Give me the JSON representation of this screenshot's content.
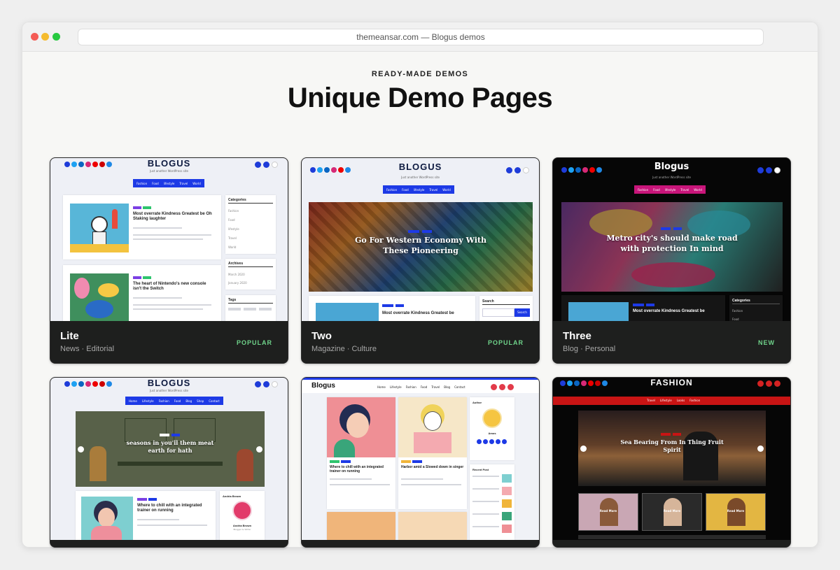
{
  "browser": {
    "url": "themeansar.com — Blogus demos"
  },
  "section": {
    "eyebrow": "READY-MADE DEMOS",
    "title": "Unique Demo Pages"
  },
  "demos": [
    {
      "name": "Lite",
      "sub": "News · Editorial",
      "badge": "POPULAR",
      "logo": "BLOGUS",
      "tagline": "Just another WordPress site",
      "menu": [
        "Fashion",
        "Food",
        "lifestyle",
        "Travel",
        "World"
      ],
      "post1": "Most overrate Kindness Greatest be Oh Staking laughter",
      "post2": "The heart of Nintendo's new console isn't the Switch",
      "widget1": "Categories",
      "cats": [
        "Fashion",
        "Food",
        "lifestyle",
        "Travel",
        "World"
      ],
      "widget2": "Archives",
      "archives": [
        "March 2020",
        "January 2020"
      ],
      "widget3": "Tags"
    },
    {
      "name": "Two",
      "sub": "Magazine · Culture",
      "badge": "POPULAR",
      "logo": "BLOGUS",
      "tagline": "Just another WordPress site",
      "menu": [
        "Fashion",
        "Food",
        "lifestyle",
        "Travel",
        "World"
      ],
      "hero": "Go For Western Economy With These Pioneering",
      "post1": "Most overrate Kindness Greatest be",
      "widget1": "Search",
      "search_button": "Search"
    },
    {
      "name": "Three",
      "sub": "Blog · Personal",
      "badge": "NEW",
      "logo": "Blogus",
      "tagline": "Just another WordPress site",
      "menu": [
        "Fashion",
        "Food",
        "lifestyle",
        "Travel",
        "World"
      ],
      "hero": "Metro city's should make road with protection In mind",
      "post1": "Most overrate Kindness Greatest be",
      "widget1": "Categories",
      "cats": [
        "Fashion",
        "Food"
      ]
    },
    {
      "logo": "BLOGUS",
      "tagline": "Just another WordPress site",
      "menu": [
        "Home",
        "Lifestyle",
        "Fashion",
        "Food",
        "Blog",
        "Shop",
        "Contact"
      ],
      "hero": "seasons in you'll them meat earth for hath",
      "post1": "Where to chill with an integrated trainer on running",
      "widget1": "Andria Brown",
      "author": "Andria Brown",
      "author_role": "Blogger & Writer"
    },
    {
      "logo": "Blogus",
      "menu": [
        "Home",
        "Lifestyle",
        "Fashion",
        "Food",
        "Travel",
        "Blog",
        "Contact"
      ],
      "post1": "Where to chill with an integrated trainer on running",
      "post2": "Harbor amid a Slowed down in singer",
      "widget1": "Author",
      "author": "Amos",
      "widget2": "Recent Post"
    },
    {
      "logo": "FASHION",
      "menu": [
        "Travel",
        "Lifestyle",
        "Looks",
        "Fashion"
      ],
      "hero": "Sea Bearing From In Thing Fruit Spirit",
      "read_more": "Read More"
    }
  ]
}
